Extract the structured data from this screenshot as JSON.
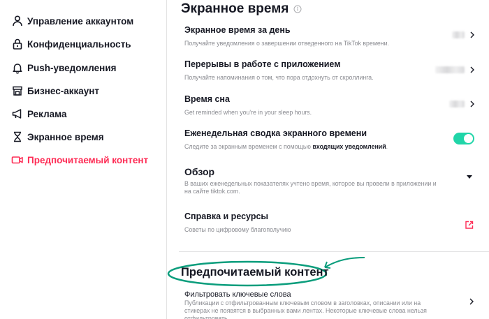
{
  "sidebar": {
    "items": [
      {
        "label": "Управление аккаунтом",
        "icon": "user-icon"
      },
      {
        "label": "Конфиденциальность",
        "icon": "lock-icon"
      },
      {
        "label": "Push-уведомления",
        "icon": "bell-icon"
      },
      {
        "label": "Бизнес-аккаунт",
        "icon": "store-icon"
      },
      {
        "label": "Реклама",
        "icon": "megaphone-icon"
      },
      {
        "label": "Экранное время",
        "icon": "hourglass-icon"
      },
      {
        "label": "Предпочитаемый контент",
        "icon": "video-camera-icon",
        "active": true
      }
    ]
  },
  "screen_time": {
    "title": "Экранное время",
    "daily": {
      "title": "Экранное время за день",
      "desc": "Получайте уведомления о завершении отведенного на TikTok времени."
    },
    "breaks": {
      "title": "Перерывы в работе с приложением",
      "desc": "Получайте напоминания о том, что пора отдохнуть от скроллинга."
    },
    "sleep": {
      "title": "Время сна",
      "desc": "Get reminded when you're in your sleep hours."
    },
    "weekly": {
      "title": "Еженедельная сводка экранного времени",
      "desc_prefix": "Следите за экранным временем с помощью",
      "desc_bold": "входящих уведомлений",
      "desc_suffix": ".",
      "toggle_on": true
    },
    "overview": {
      "title": "Обзор",
      "desc": "В ваших еженедельных показателях учтено время, которое вы провели в приложении и на сайте tiktok.com."
    },
    "help": {
      "title": "Справка и ресурсы",
      "desc": "Советы по цифровому благополучию"
    }
  },
  "preferred_content": {
    "title": "Предпочитаемый контент",
    "filter": {
      "title": "Фильтровать ключевые слова",
      "desc": "Публикации с отфильтрованным ключевым словом в заголовках, описании или на стикерах не появятся в выбранных вами лентах. Некоторые ключевые слова нельзя отфильтровать."
    }
  },
  "colors": {
    "accent": "#fe2c55",
    "toggle": "#20d5a8",
    "annotation": "#0a9d7c"
  }
}
